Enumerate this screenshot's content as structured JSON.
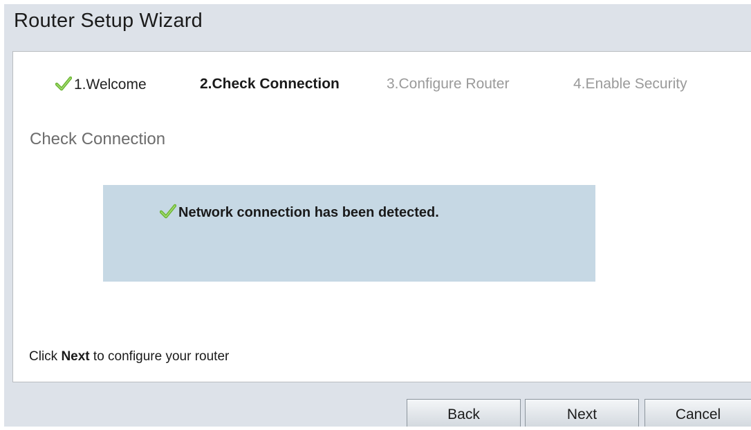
{
  "header": {
    "title": "Router Setup Wizard"
  },
  "steps": [
    {
      "label": "1.Welcome",
      "state": "completed",
      "icon": "checkmark-icon"
    },
    {
      "label": "2.Check Connection",
      "state": "current"
    },
    {
      "label": "3.Configure Router",
      "state": "pending"
    },
    {
      "label": "4.Enable Security",
      "state": "pending"
    }
  ],
  "section": {
    "heading": "Check Connection"
  },
  "status": {
    "message": "Network connection has been detected.",
    "icon": "checkmark-icon",
    "box_color": "#c6d8e4"
  },
  "instruction": {
    "prefix": "Click ",
    "emphasis": "Next",
    "suffix": " to configure your router"
  },
  "buttons": {
    "back": "Back",
    "next": "Next",
    "cancel": "Cancel"
  },
  "colors": {
    "background": "#dde2e9",
    "check_green": "#6bb534",
    "pending_text": "#9a9a9a"
  }
}
